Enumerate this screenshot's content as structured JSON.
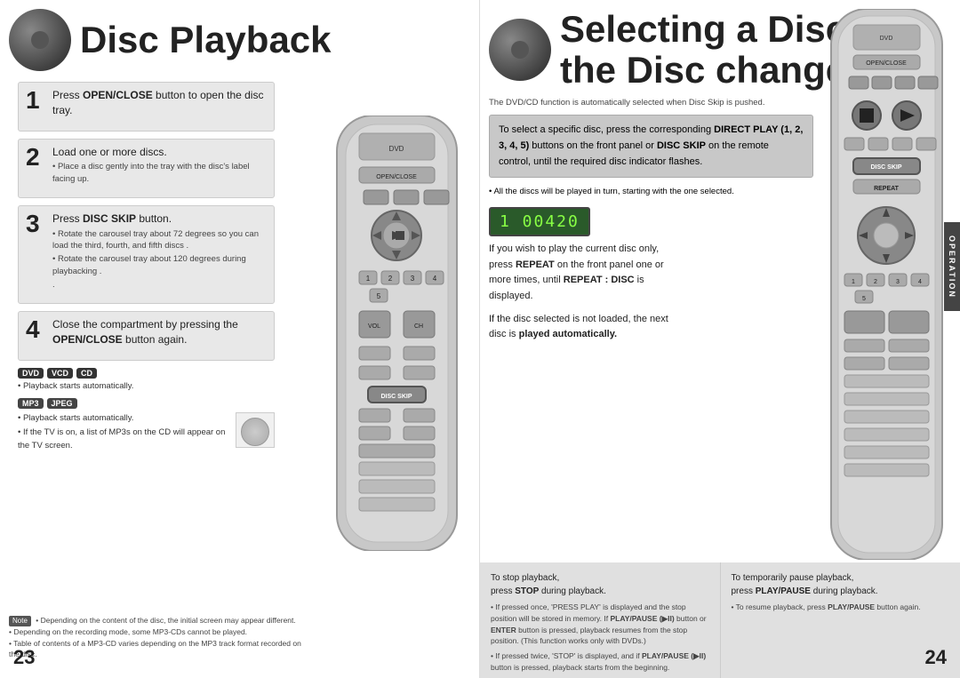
{
  "left_page": {
    "title": "Disc Playback",
    "page_number": "23",
    "steps": [
      {
        "number": "1",
        "title": "Press OPEN/CLOSE button to open the disc tray.",
        "details": []
      },
      {
        "number": "2",
        "title": "Load one or more discs.",
        "details": [
          "Place a disc gently into the tray with the disc's label facing up."
        ]
      },
      {
        "number": "3",
        "title": "Press DISC SKIP button.",
        "details": [
          "Rotate the carousel tray about 72 degrees so you can load the third, fourth, and fifth discs .",
          "Rotate the carousel tray about 120 degrees during playbacking ."
        ]
      },
      {
        "number": "4",
        "title": "Close the compartment by pressing the OPEN/CLOSE button again.",
        "details": []
      }
    ],
    "badges_dvd": [
      "DVD",
      "VCD",
      "CD"
    ],
    "badges_mp3": [
      "MP3",
      "JPEG"
    ],
    "playback_auto": "Playback starts automatically.",
    "tv_note": "If the TV is on, a list of MP3s on the CD will appear on the TV screen.",
    "notes": [
      "Depending on the content of the disc, the initial screen may appear different.",
      "Depending on the recording mode, some MP3-CDs cannot be played.",
      "Table of contents of a MP3-CD varies depending on the MP3 track format recorded on the disc."
    ]
  },
  "right_page": {
    "title": "Selecting a Disc in the Disc changer",
    "page_number": "24",
    "subtitle": "The DVD/CD function is automatically selected when Disc Skip is pushed.",
    "highlight_text": "To select a specific disc, press the corresponding DIRECT PLAY (1, 2, 3, 4, 5) buttons on the front panel or DISC SKIP on the remote control, until the required disc indicator flashes.",
    "all_discs_note": "All the discs will be played in turn, starting with the one selected.",
    "display_value": "1  00420",
    "repeat_text": "If you wish to play the current disc only, press REPEAT on the front panel one or more times, until REPEAT : DISC is displayed.",
    "auto_text": "If the disc selected is not loaded, the next disc is played automatically.",
    "stop_section": {
      "title": "To stop playback,",
      "subtitle": "press STOP during playback.",
      "detail_lines": [
        "If pressed once, 'PRESS PLAY' is displayed and the stop position will be stored in memory. If PLAY/PAUSE (  ) button or ENTER button is pressed, playback resumes from the stop position. (This function works only with DVDs.)",
        "If pressed twice, 'STOP' is displayed, and if PLAY/PAUSE (  ) button is pressed, playback starts from the beginning."
      ]
    },
    "pause_section": {
      "title": "To temporarily pause playback,",
      "subtitle": "press PLAY/PAUSE during playback.",
      "detail": "To resume playback, press PLAY/PAUSE button again."
    },
    "operation_label": "OPERATION"
  }
}
